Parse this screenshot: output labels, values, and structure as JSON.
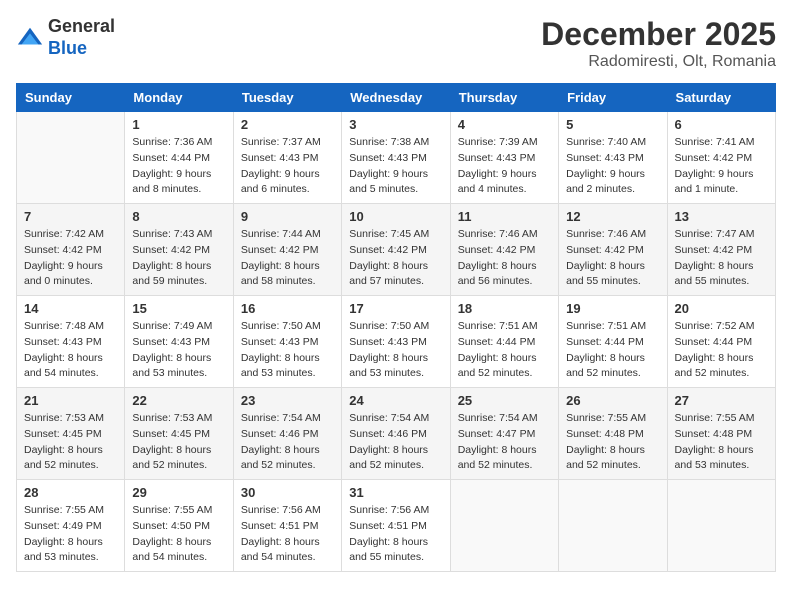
{
  "header": {
    "logo": {
      "general": "General",
      "blue": "Blue"
    },
    "title": "December 2025",
    "location": "Radomiresti, Olt, Romania"
  },
  "calendar": {
    "days_of_week": [
      "Sunday",
      "Monday",
      "Tuesday",
      "Wednesday",
      "Thursday",
      "Friday",
      "Saturday"
    ],
    "weeks": [
      [
        {
          "day": "",
          "sunrise": "",
          "sunset": "",
          "daylight": ""
        },
        {
          "day": "1",
          "sunrise": "Sunrise: 7:36 AM",
          "sunset": "Sunset: 4:44 PM",
          "daylight": "Daylight: 9 hours and 8 minutes."
        },
        {
          "day": "2",
          "sunrise": "Sunrise: 7:37 AM",
          "sunset": "Sunset: 4:43 PM",
          "daylight": "Daylight: 9 hours and 6 minutes."
        },
        {
          "day": "3",
          "sunrise": "Sunrise: 7:38 AM",
          "sunset": "Sunset: 4:43 PM",
          "daylight": "Daylight: 9 hours and 5 minutes."
        },
        {
          "day": "4",
          "sunrise": "Sunrise: 7:39 AM",
          "sunset": "Sunset: 4:43 PM",
          "daylight": "Daylight: 9 hours and 4 minutes."
        },
        {
          "day": "5",
          "sunrise": "Sunrise: 7:40 AM",
          "sunset": "Sunset: 4:43 PM",
          "daylight": "Daylight: 9 hours and 2 minutes."
        },
        {
          "day": "6",
          "sunrise": "Sunrise: 7:41 AM",
          "sunset": "Sunset: 4:42 PM",
          "daylight": "Daylight: 9 hours and 1 minute."
        }
      ],
      [
        {
          "day": "7",
          "sunrise": "Sunrise: 7:42 AM",
          "sunset": "Sunset: 4:42 PM",
          "daylight": "Daylight: 9 hours and 0 minutes."
        },
        {
          "day": "8",
          "sunrise": "Sunrise: 7:43 AM",
          "sunset": "Sunset: 4:42 PM",
          "daylight": "Daylight: 8 hours and 59 minutes."
        },
        {
          "day": "9",
          "sunrise": "Sunrise: 7:44 AM",
          "sunset": "Sunset: 4:42 PM",
          "daylight": "Daylight: 8 hours and 58 minutes."
        },
        {
          "day": "10",
          "sunrise": "Sunrise: 7:45 AM",
          "sunset": "Sunset: 4:42 PM",
          "daylight": "Daylight: 8 hours and 57 minutes."
        },
        {
          "day": "11",
          "sunrise": "Sunrise: 7:46 AM",
          "sunset": "Sunset: 4:42 PM",
          "daylight": "Daylight: 8 hours and 56 minutes."
        },
        {
          "day": "12",
          "sunrise": "Sunrise: 7:46 AM",
          "sunset": "Sunset: 4:42 PM",
          "daylight": "Daylight: 8 hours and 55 minutes."
        },
        {
          "day": "13",
          "sunrise": "Sunrise: 7:47 AM",
          "sunset": "Sunset: 4:42 PM",
          "daylight": "Daylight: 8 hours and 55 minutes."
        }
      ],
      [
        {
          "day": "14",
          "sunrise": "Sunrise: 7:48 AM",
          "sunset": "Sunset: 4:43 PM",
          "daylight": "Daylight: 8 hours and 54 minutes."
        },
        {
          "day": "15",
          "sunrise": "Sunrise: 7:49 AM",
          "sunset": "Sunset: 4:43 PM",
          "daylight": "Daylight: 8 hours and 53 minutes."
        },
        {
          "day": "16",
          "sunrise": "Sunrise: 7:50 AM",
          "sunset": "Sunset: 4:43 PM",
          "daylight": "Daylight: 8 hours and 53 minutes."
        },
        {
          "day": "17",
          "sunrise": "Sunrise: 7:50 AM",
          "sunset": "Sunset: 4:43 PM",
          "daylight": "Daylight: 8 hours and 53 minutes."
        },
        {
          "day": "18",
          "sunrise": "Sunrise: 7:51 AM",
          "sunset": "Sunset: 4:44 PM",
          "daylight": "Daylight: 8 hours and 52 minutes."
        },
        {
          "day": "19",
          "sunrise": "Sunrise: 7:51 AM",
          "sunset": "Sunset: 4:44 PM",
          "daylight": "Daylight: 8 hours and 52 minutes."
        },
        {
          "day": "20",
          "sunrise": "Sunrise: 7:52 AM",
          "sunset": "Sunset: 4:44 PM",
          "daylight": "Daylight: 8 hours and 52 minutes."
        }
      ],
      [
        {
          "day": "21",
          "sunrise": "Sunrise: 7:53 AM",
          "sunset": "Sunset: 4:45 PM",
          "daylight": "Daylight: 8 hours and 52 minutes."
        },
        {
          "day": "22",
          "sunrise": "Sunrise: 7:53 AM",
          "sunset": "Sunset: 4:45 PM",
          "daylight": "Daylight: 8 hours and 52 minutes."
        },
        {
          "day": "23",
          "sunrise": "Sunrise: 7:54 AM",
          "sunset": "Sunset: 4:46 PM",
          "daylight": "Daylight: 8 hours and 52 minutes."
        },
        {
          "day": "24",
          "sunrise": "Sunrise: 7:54 AM",
          "sunset": "Sunset: 4:46 PM",
          "daylight": "Daylight: 8 hours and 52 minutes."
        },
        {
          "day": "25",
          "sunrise": "Sunrise: 7:54 AM",
          "sunset": "Sunset: 4:47 PM",
          "daylight": "Daylight: 8 hours and 52 minutes."
        },
        {
          "day": "26",
          "sunrise": "Sunrise: 7:55 AM",
          "sunset": "Sunset: 4:48 PM",
          "daylight": "Daylight: 8 hours and 52 minutes."
        },
        {
          "day": "27",
          "sunrise": "Sunrise: 7:55 AM",
          "sunset": "Sunset: 4:48 PM",
          "daylight": "Daylight: 8 hours and 53 minutes."
        }
      ],
      [
        {
          "day": "28",
          "sunrise": "Sunrise: 7:55 AM",
          "sunset": "Sunset: 4:49 PM",
          "daylight": "Daylight: 8 hours and 53 minutes."
        },
        {
          "day": "29",
          "sunrise": "Sunrise: 7:55 AM",
          "sunset": "Sunset: 4:50 PM",
          "daylight": "Daylight: 8 hours and 54 minutes."
        },
        {
          "day": "30",
          "sunrise": "Sunrise: 7:56 AM",
          "sunset": "Sunset: 4:51 PM",
          "daylight": "Daylight: 8 hours and 54 minutes."
        },
        {
          "day": "31",
          "sunrise": "Sunrise: 7:56 AM",
          "sunset": "Sunset: 4:51 PM",
          "daylight": "Daylight: 8 hours and 55 minutes."
        },
        {
          "day": "",
          "sunrise": "",
          "sunset": "",
          "daylight": ""
        },
        {
          "day": "",
          "sunrise": "",
          "sunset": "",
          "daylight": ""
        },
        {
          "day": "",
          "sunrise": "",
          "sunset": "",
          "daylight": ""
        }
      ]
    ]
  }
}
